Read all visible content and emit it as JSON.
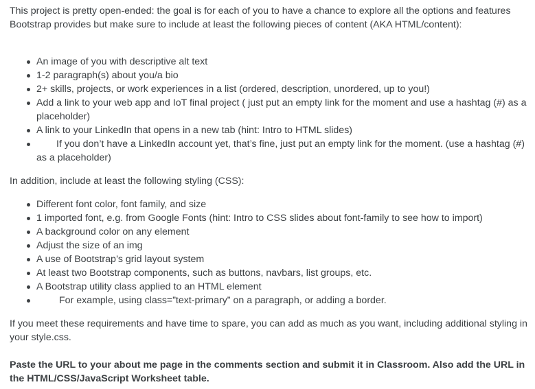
{
  "intro": "This project is pretty open-ended: the goal is for each of you to have a chance to explore all the options and features Bootstrap provides but make sure to include at least the following pieces of content (AKA HTML/content):",
  "content_items": [
    "An image of you with descriptive alt text",
    "1-2 paragraph(s) about you/a bio",
    "2+ skills, projects, or work experiences in a list (ordered, description, unordered, up to you!)",
    "Add a link to your web app and IoT final project ( just put an empty link for the moment and use a hashtag (#) as a placeholder)",
    "A link to your LinkedIn that opens in a new tab (hint: Intro to HTML slides)",
    "If you don’t have a LinkedIn account yet, that’s fine, just put an empty link for the moment. (use a hashtag (#) as a placeholder)"
  ],
  "styling_intro": "In addition, include at least the following styling (CSS):",
  "styling_items": [
    "Different font color, font family, and size",
    "1 imported font, e.g. from Google Fonts (hint: Intro to CSS slides about font-family to see how to import)",
    "A background color on any element",
    "Adjust the size of an img",
    "A use of Bootstrap’s grid layout system",
    "At least two Bootstrap components, such as buttons, navbars, list groups, etc.",
    "A Bootstrap utility class applied to an HTML element",
    "For example, using class=”text-primary” on a paragraph, or adding a border."
  ],
  "outro": "If you meet these requirements and have time to spare, you can add as much as you want, including additional styling in your style.css.",
  "final_instruction": "Paste the URL to your about me page in the comments section and submit it in Classroom. Also add the URL in the HTML/CSS/JavaScript Worksheet table."
}
